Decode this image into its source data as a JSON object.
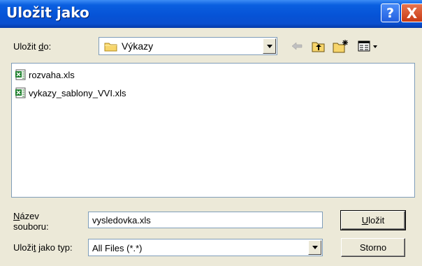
{
  "dialog": {
    "title": "Uložit jako",
    "help_glyph": "?",
    "close_glyph": "X"
  },
  "location": {
    "label_pre": "Uložit ",
    "label_accel": "d",
    "label_post": "o:",
    "value": "Výkazy",
    "icon": "folder-icon"
  },
  "toolbar": {
    "back_icon": "back-arrow-icon",
    "up_icon": "up-folder-icon",
    "new_folder_icon": "new-folder-icon",
    "view_icon": "view-menu-icon"
  },
  "files": [
    {
      "name": "rozvaha.xls",
      "icon": "excel-file-icon"
    },
    {
      "name": "vykazy_sablony_VVI.xls",
      "icon": "excel-file-icon"
    }
  ],
  "filename": {
    "label_accel": "N",
    "label_post": "ázev",
    "label_line2": "souboru:",
    "value": "vysledovka.xls"
  },
  "filetype": {
    "label_pre": "Uloži",
    "label_accel": "t",
    "label_post": " jako typ:",
    "value": "All Files (*.*)"
  },
  "buttons": {
    "save_accel": "U",
    "save_post": "ložit",
    "cancel": "Storno"
  },
  "colors": {
    "titlebar": "#0653d6",
    "dialog_bg": "#ece9d8",
    "close_button": "#c83a13"
  }
}
